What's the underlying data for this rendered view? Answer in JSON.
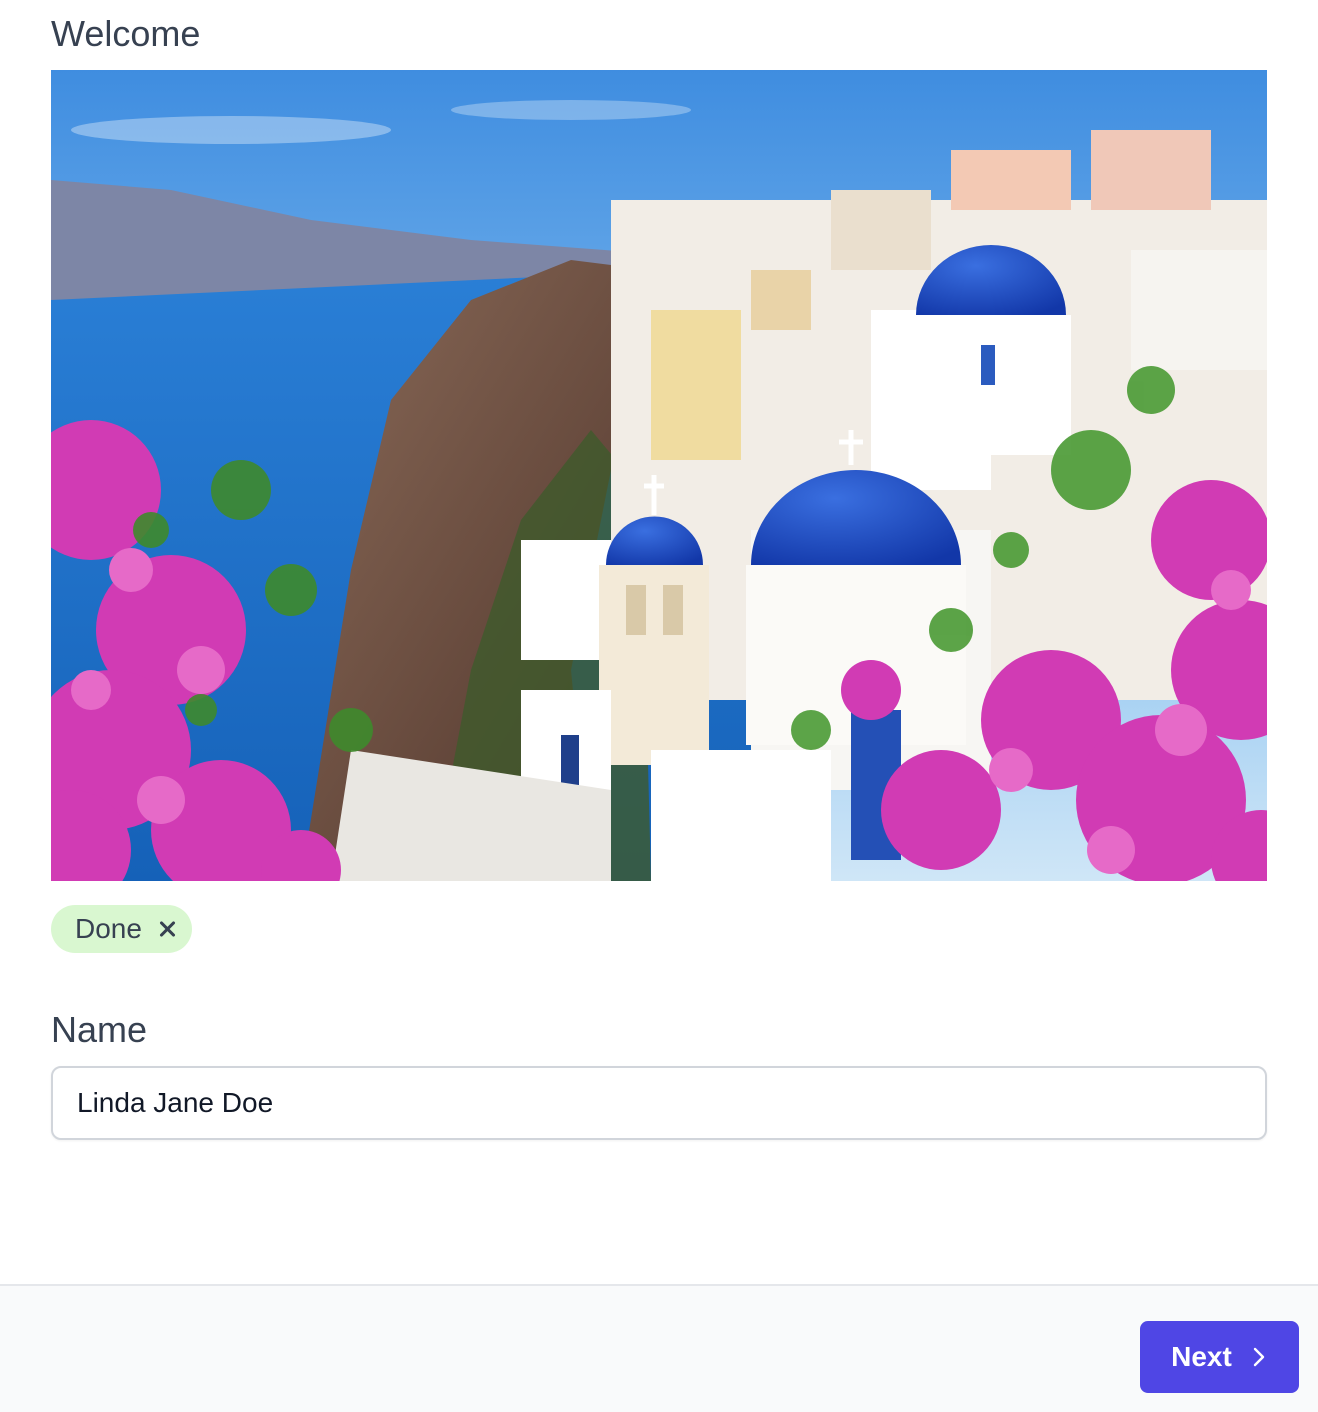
{
  "header": {
    "title": "Welcome"
  },
  "hero": {
    "alt": "Santorini village with blue domes and pink bougainvillea"
  },
  "status_chip": {
    "label": "Done",
    "close_icon": "x-icon",
    "color": "#d9f7d0"
  },
  "form": {
    "name_label": "Name",
    "name_value": "Linda Jane Doe"
  },
  "footer": {
    "next_label": "Next",
    "next_icon": "chevron-right-icon",
    "accent": "#4f46e5"
  }
}
